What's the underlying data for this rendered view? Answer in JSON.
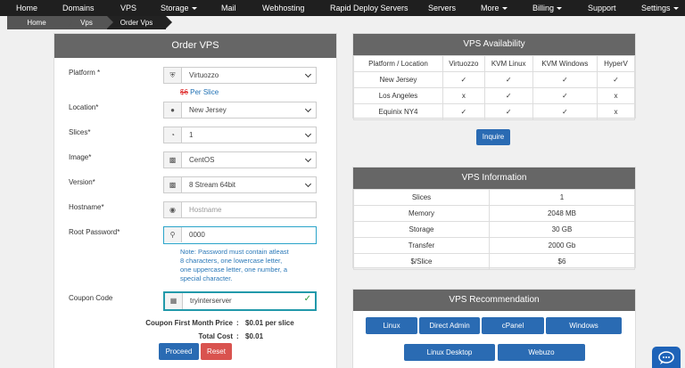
{
  "nav": [
    {
      "label": "Home",
      "caret": false
    },
    {
      "label": "Domains",
      "caret": false
    },
    {
      "label": "VPS",
      "caret": false
    },
    {
      "label": "Storage",
      "caret": true
    },
    {
      "label": "Mail",
      "caret": false
    },
    {
      "label": "Webhosting",
      "caret": false
    },
    {
      "label": "Rapid Deploy Servers",
      "caret": false
    },
    {
      "label": "Servers",
      "caret": false
    },
    {
      "label": "More",
      "caret": true
    },
    {
      "label": "Billing",
      "caret": true
    },
    {
      "label": "Support",
      "caret": false
    },
    {
      "label": "Settings",
      "caret": true
    }
  ],
  "breadcrumb": [
    "Home",
    "Vps",
    "Order Vps"
  ],
  "order": {
    "title": "Order VPS",
    "platform": {
      "label": "Platform *",
      "value": "Virtuozzo",
      "old_price": "$6",
      "price_note": "Per Slice"
    },
    "location": {
      "label": "Location*",
      "value": "New Jersey"
    },
    "slices": {
      "label": "Slices*",
      "value": "1"
    },
    "image": {
      "label": "Image*",
      "value": "CentOS"
    },
    "version": {
      "label": "Version*",
      "value": "8 Stream 64bit"
    },
    "hostname": {
      "label": "Hostname*",
      "placeholder": "Hostname"
    },
    "root_password": {
      "label": "Root Password*",
      "value": "0000"
    },
    "password_note": [
      "Note: Password must contain atleast",
      "8 characters, one lowercase letter,",
      "one uppercase letter, one number, a",
      "special character."
    ],
    "coupon": {
      "label": "Coupon Code",
      "value": "tryinterserver"
    },
    "coupon_price": {
      "label": "Coupon First Month Price",
      "sep": ":",
      "value": "$0.01 per slice"
    },
    "total": {
      "label": "Total Cost",
      "sep": ":",
      "value": "$0.01"
    },
    "proceed": "Proceed",
    "reset": "Reset"
  },
  "availability": {
    "title": "VPS Availability",
    "headers": [
      "Platform / Location",
      "Virtuozzo",
      "KVM Linux",
      "KVM Windows",
      "HyperV"
    ],
    "rows": [
      {
        "location": "New Jersey",
        "marks": [
          "check",
          "check",
          "check",
          "check"
        ]
      },
      {
        "location": "Los Angeles",
        "marks": [
          "cross",
          "check",
          "check",
          "cross"
        ]
      },
      {
        "location": "Equinix NY4",
        "marks": [
          "check",
          "check",
          "check",
          "cross"
        ]
      }
    ],
    "inquire": "Inquire"
  },
  "info": {
    "title": "VPS Information",
    "rows": [
      [
        "Slices",
        "1"
      ],
      [
        "Memory",
        "2048 MB"
      ],
      [
        "Storage",
        "30 GB"
      ],
      [
        "Transfer",
        "2000 Gb"
      ],
      [
        "$/Slice",
        "$6"
      ]
    ]
  },
  "recommendation": {
    "title": "VPS Recommendation",
    "row1": [
      "Linux",
      "Direct Admin",
      "cPanel",
      "Windows"
    ],
    "row2": [
      "Linux Desktop",
      "Webuzo"
    ]
  },
  "glyphs": {
    "check": "✓",
    "cross": "x"
  },
  "colors": {
    "nav_bg": "#1f1f1f",
    "panel_head": "#666666",
    "primary": "#2a6bb3",
    "danger": "#d9534f",
    "check": "#2b9a3a",
    "cross": "#dd2222",
    "accent": "#2aa4c9"
  },
  "icons": {
    "platform": "shield-icon",
    "location": "map-pin-icon",
    "slices": "pie-chart-icon",
    "image": "file-icon",
    "version": "file-icon",
    "hostname": "globe-icon",
    "password": "key-icon",
    "coupon": "barcode-icon",
    "chat": "chat-icon"
  }
}
